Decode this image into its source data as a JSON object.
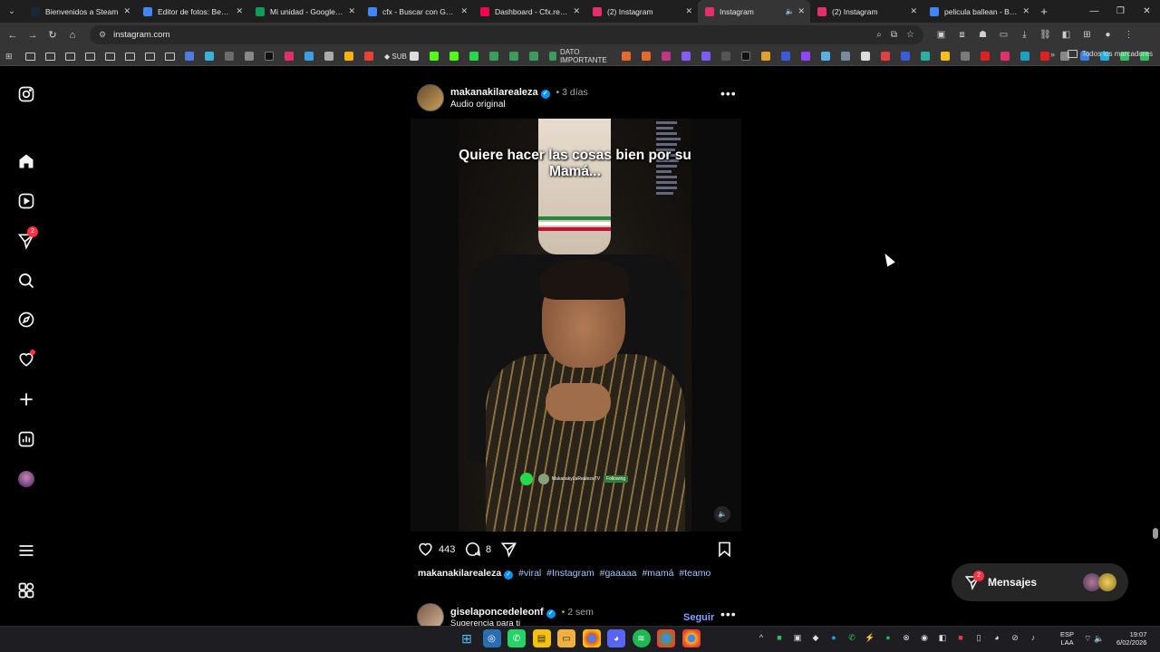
{
  "browser": {
    "tabs": [
      {
        "title": "Bienvenidos a Steam",
        "color": "#1b2838"
      },
      {
        "title": "Editor de fotos: BeFunky",
        "color": "#4285f4"
      },
      {
        "title": "Mi unidad - Google Drive",
        "color": "#0f9d58"
      },
      {
        "title": "cfx - Buscar con Google",
        "color": "#4285f4"
      },
      {
        "title": "Dashboard - Cfx.re Portal",
        "color": "#f40552"
      },
      {
        "title": "(2) Instagram",
        "color": "#e1306c"
      },
      {
        "title": "Instagram",
        "color": "#e1306c",
        "active": true
      },
      {
        "title": "(2) Instagram",
        "color": "#e1306c"
      },
      {
        "title": "pelicula ballean - Buscar",
        "color": "#4285f4"
      }
    ],
    "url": "instagram.com",
    "bookmarks": [
      {
        "label": "SUB"
      },
      {
        "label": "DATO IMPORTANTE"
      }
    ],
    "all_bookmarks": "Todos los marcadores"
  },
  "nav": {
    "notifications_badge": "2"
  },
  "post": {
    "username": "makanakilarealeza",
    "time": "3 días",
    "audio": "Audio original",
    "video_caption": "Quiere hacer las cosas bien por su Mamá...",
    "overlay_channel": "MakanakyLaRealezaTV",
    "overlay_following": "Following",
    "likes": "443",
    "comments": "8",
    "caption_user": "makanakilarealeza",
    "hashtags": [
      "#viral",
      "#Instagram",
      "#gaaaaa",
      "#mamá",
      "#teamo"
    ]
  },
  "next_post": {
    "username": "giselaponcedeleonf",
    "time": "2 sem",
    "subtitle": "Sugerencia para ti",
    "follow_label": "Seguir"
  },
  "messages": {
    "label": "Mensajes",
    "badge": "2"
  },
  "taskbar": {
    "lang_line1": "ESP",
    "lang_line2": "LAA",
    "time": "19:07",
    "date": "6/02/2026"
  },
  "colors": {
    "background": "#000000",
    "accent_blue": "#0095f6",
    "badge_red": "#ff3040",
    "follow_blue": "#85a1ff"
  }
}
